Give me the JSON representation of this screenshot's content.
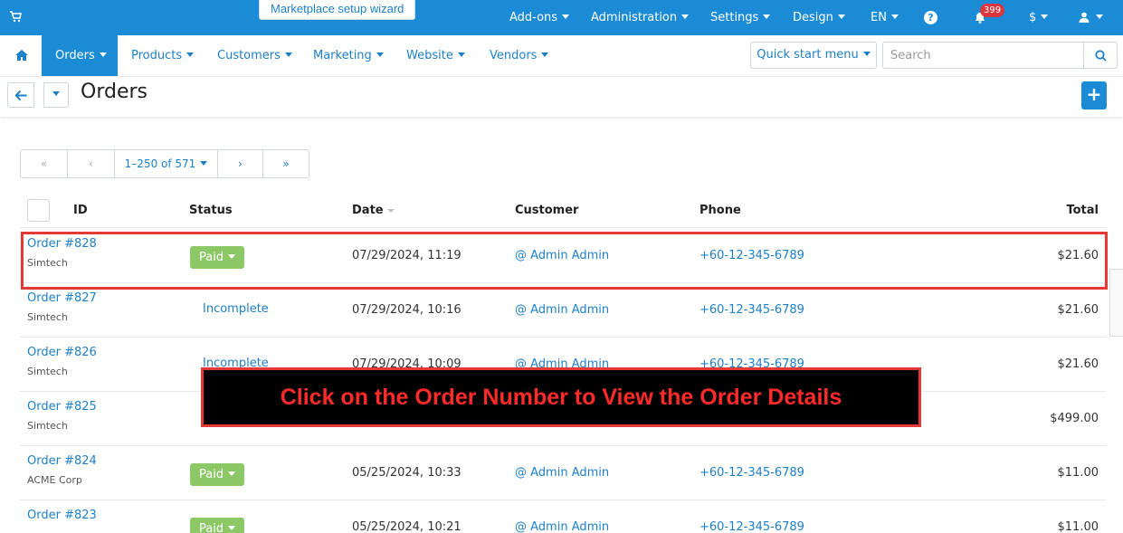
{
  "topbar": {
    "wizard_label": "Marketplace setup wizard",
    "menu": [
      {
        "label": "Add-ons"
      },
      {
        "label": "Administration"
      },
      {
        "label": "Settings"
      },
      {
        "label": "Design"
      },
      {
        "label": "EN"
      }
    ],
    "notifications_count": "399",
    "currency_label": "$"
  },
  "nav": {
    "items": [
      {
        "label": "Orders"
      },
      {
        "label": "Products"
      },
      {
        "label": "Customers"
      },
      {
        "label": "Marketing"
      },
      {
        "label": "Website"
      },
      {
        "label": "Vendors"
      }
    ],
    "quick_start_label": "Quick start menu",
    "search_placeholder": "Search"
  },
  "page": {
    "title": "Orders",
    "add_label": "+"
  },
  "pagination": {
    "first": "«",
    "prev": "‹",
    "range": "1–250 of 571",
    "next": "›",
    "last": "»"
  },
  "table": {
    "columns": {
      "id": "ID",
      "status": "Status",
      "date": "Date",
      "customer": "Customer",
      "phone": "Phone",
      "total": "Total"
    },
    "rows": [
      {
        "order": "Order #828",
        "company": "Simtech",
        "status": "Paid",
        "date": "07/29/2024, 11:19",
        "customer": "@ Admin Admin",
        "phone": "+60-12-345-6789",
        "total": "$21.60"
      },
      {
        "order": "Order #827",
        "company": "Simtech",
        "status": "Incomplete",
        "date": "07/29/2024, 10:16",
        "customer": "@ Admin Admin",
        "phone": "+60-12-345-6789",
        "total": "$21.60"
      },
      {
        "order": "Order #826",
        "company": "Simtech",
        "status": "Incomplete",
        "date": "07/29/2024, 10:09",
        "customer": "@ Admin Admin",
        "phone": "+60-12-345-6789",
        "total": "$21.60"
      },
      {
        "order": "Order #825",
        "company": "Simtech",
        "status": "",
        "date": "",
        "customer": "",
        "phone": "",
        "total": "$499.00"
      },
      {
        "order": "Order #824",
        "company": "ACME Corp",
        "status": "Paid",
        "date": "05/25/2024, 10:33",
        "customer": "@ Admin Admin",
        "phone": "+60-12-345-6789",
        "total": "$11.00"
      },
      {
        "order": "Order #823",
        "company": "",
        "status": "Paid",
        "date": "05/25/2024, 10:21",
        "customer": "@ Admin Admin",
        "phone": "+60-12-345-6789",
        "total": "$11.00"
      }
    ]
  },
  "callout": {
    "text": "Click on the Order Number to View the Order Details"
  },
  "colors": {
    "primary": "#1b8bd6",
    "link": "#1e7fc9",
    "paid": "#8dc867",
    "highlight": "#e53935",
    "badge": "#d9363e"
  }
}
